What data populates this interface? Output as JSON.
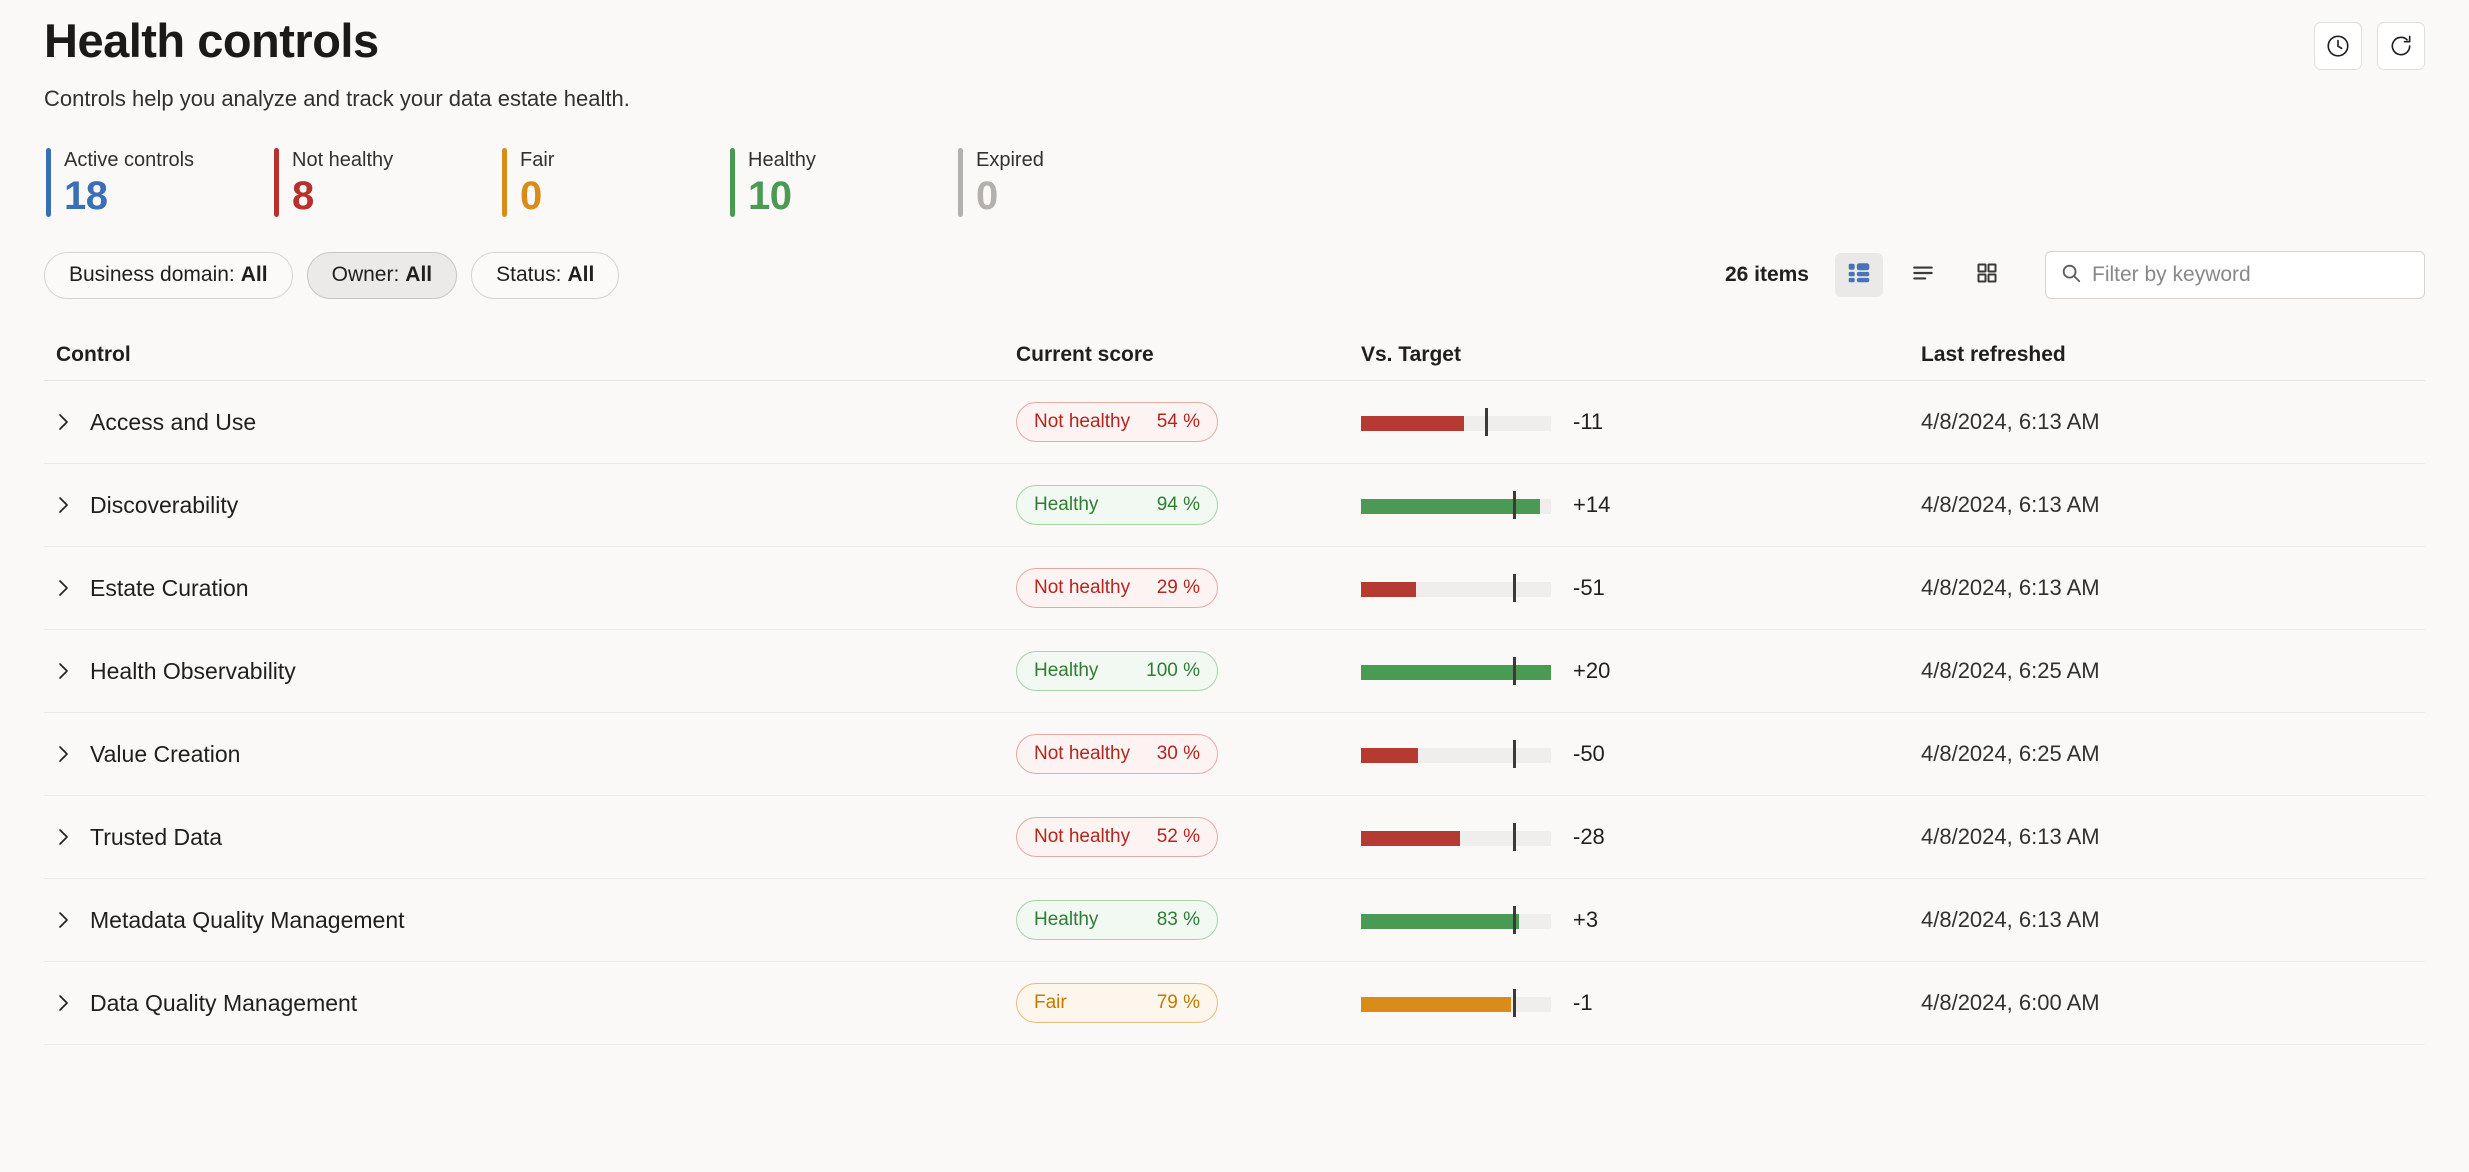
{
  "header": {
    "title": "Health controls",
    "subtitle": "Controls help you analyze and track your data estate health.",
    "actions": [
      {
        "name": "history-icon",
        "label": "History"
      },
      {
        "name": "refresh-icon",
        "label": "Refresh"
      }
    ]
  },
  "stats": [
    {
      "label": "Active controls",
      "value": "18",
      "color": "#3b6fb5"
    },
    {
      "label": "Not healthy",
      "value": "8",
      "color": "#b8302c"
    },
    {
      "label": "Fair",
      "value": "0",
      "color": "#d98c18"
    },
    {
      "label": "Healthy",
      "value": "10",
      "color": "#4a9a54"
    },
    {
      "label": "Expired",
      "value": "0",
      "color": "#b3b0ad"
    }
  ],
  "filters": {
    "chips": [
      {
        "label": "Business domain:",
        "value": "All",
        "hovered": false
      },
      {
        "label": "Owner:",
        "value": "All",
        "hovered": true
      },
      {
        "label": "Status:",
        "value": "All",
        "hovered": false
      }
    ],
    "item_count": "26 items",
    "views": [
      {
        "name": "table-view-icon",
        "active": true
      },
      {
        "name": "list-view-icon",
        "active": false
      },
      {
        "name": "tile-view-icon",
        "active": false
      }
    ],
    "search": {
      "placeholder": "Filter by keyword",
      "value": ""
    }
  },
  "table": {
    "columns": [
      {
        "key": "control",
        "label": "Control"
      },
      {
        "key": "score",
        "label": "Current score"
      },
      {
        "key": "target",
        "label": "Vs. Target"
      },
      {
        "key": "refresh",
        "label": "Last refreshed"
      }
    ],
    "rows": [
      {
        "control": "Access and Use",
        "status": "Not healthy",
        "status_key": "notHealthy",
        "score": "54 %",
        "score_pct": 54,
        "target_pct": 65,
        "delta": "-11",
        "refreshed": "4/8/2024, 6:13 AM"
      },
      {
        "control": "Discoverability",
        "status": "Healthy",
        "status_key": "healthy",
        "score": "94 %",
        "score_pct": 94,
        "target_pct": 80,
        "delta": "+14",
        "refreshed": "4/8/2024, 6:13 AM"
      },
      {
        "control": "Estate Curation",
        "status": "Not healthy",
        "status_key": "notHealthy",
        "score": "29 %",
        "score_pct": 29,
        "target_pct": 80,
        "delta": "-51",
        "refreshed": "4/8/2024, 6:13 AM"
      },
      {
        "control": "Health Observability",
        "status": "Healthy",
        "status_key": "healthy",
        "score": "100 %",
        "score_pct": 100,
        "target_pct": 80,
        "delta": "+20",
        "refreshed": "4/8/2024, 6:25 AM"
      },
      {
        "control": "Value Creation",
        "status": "Not healthy",
        "status_key": "notHealthy",
        "score": "30 %",
        "score_pct": 30,
        "target_pct": 80,
        "delta": "-50",
        "refreshed": "4/8/2024, 6:25 AM"
      },
      {
        "control": "Trusted Data",
        "status": "Not healthy",
        "status_key": "notHealthy",
        "score": "52 %",
        "score_pct": 52,
        "target_pct": 80,
        "delta": "-28",
        "refreshed": "4/8/2024, 6:13 AM"
      },
      {
        "control": "Metadata Quality Management",
        "status": "Healthy",
        "status_key": "healthy",
        "score": "83 %",
        "score_pct": 83,
        "target_pct": 80,
        "delta": "+3",
        "refreshed": "4/8/2024, 6:13 AM"
      },
      {
        "control": "Data Quality Management",
        "status": "Fair",
        "status_key": "fair",
        "score": "79 %",
        "score_pct": 79,
        "target_pct": 80,
        "delta": "-1",
        "refreshed": "4/8/2024, 6:00 AM"
      }
    ]
  }
}
